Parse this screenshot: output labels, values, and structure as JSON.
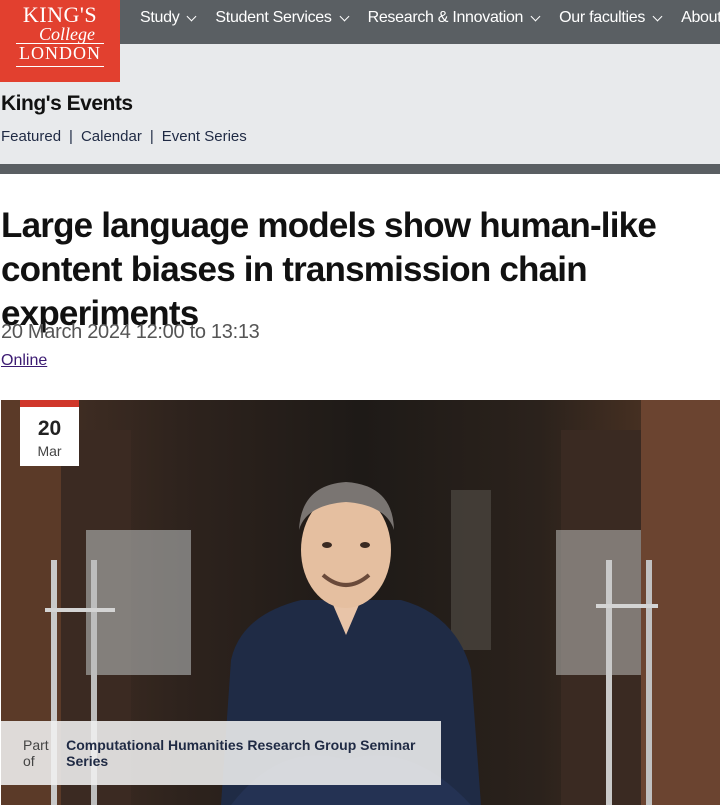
{
  "logo": {
    "line1": "KING'S",
    "line2": "College",
    "line3": "LONDON"
  },
  "nav": {
    "items": [
      {
        "label": "Study"
      },
      {
        "label": "Student Services"
      },
      {
        "label": "Research & Innovation"
      },
      {
        "label": "Our faculties"
      },
      {
        "label": "About"
      }
    ]
  },
  "section": {
    "title": "King's Events",
    "subnav": [
      "Featured",
      "Calendar",
      "Event Series"
    ]
  },
  "event": {
    "title": "Large language models show human-like content biases in transmission chain experiments",
    "datetime": "20 March 2024 12:00 to 13:13",
    "location": "Online",
    "badge_day": "20",
    "badge_month": "Mar",
    "series_prefix": "Part of",
    "series_name": "Computational Humanities Research Group Seminar Series"
  },
  "colors": {
    "brand_red": "#e2402f",
    "nav_grey": "#5a5f63",
    "subheader_bg": "#e8eaec",
    "link_purple": "#3b1a72"
  }
}
